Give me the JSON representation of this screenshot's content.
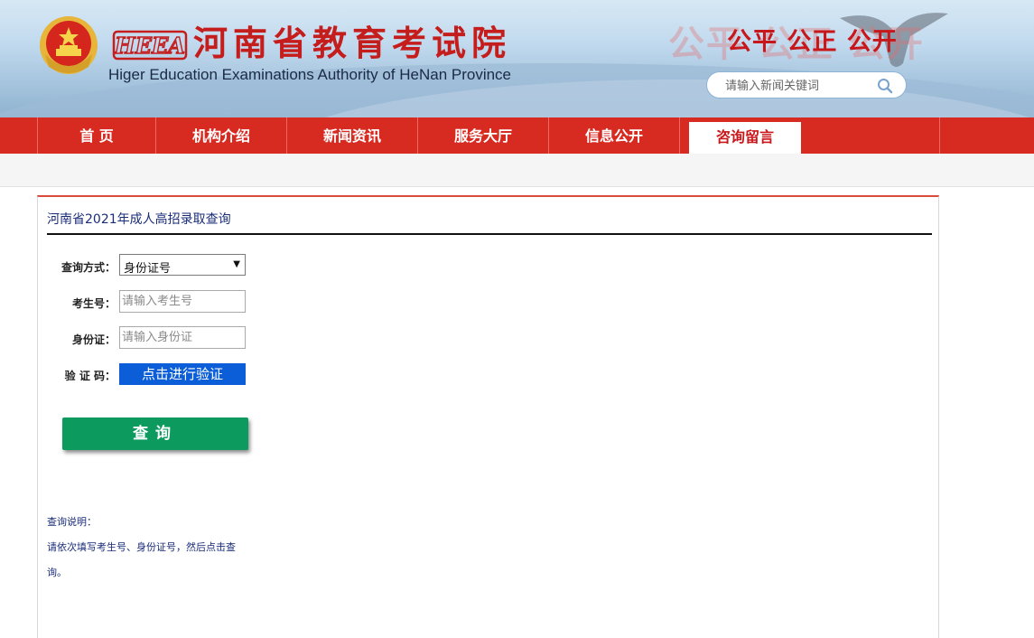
{
  "header": {
    "title": "河南省教育考试院",
    "subtitle": "Higer Education Examinations Authority of HeNan Province",
    "logo_text": "HEEA",
    "slogan": "公平 公正 公开",
    "search": {
      "placeholder": "请输入新闻关键词",
      "icon": "search-icon"
    }
  },
  "nav": {
    "items": [
      {
        "label": "首 页"
      },
      {
        "label": "机构介绍"
      },
      {
        "label": "新闻资讯"
      },
      {
        "label": "服务大厅"
      },
      {
        "label": "信息公开"
      },
      {
        "label": "咨询留言",
        "active": true
      }
    ]
  },
  "main": {
    "title": "河南省2021年成人高招录取查询",
    "form": {
      "method_label": "查询方式：",
      "method_value": "身份证号",
      "exam_no_label": "考生号：",
      "exam_no_placeholder": "请输入考生号",
      "id_label": "身份证：",
      "id_placeholder": "请输入身份证",
      "captcha_label": "验 证 码：",
      "captcha_button": "点击进行验证",
      "submit": "查询"
    },
    "notes": {
      "heading": "查询说明：",
      "line1": "请依次填写考生号、身份证号，然后点击查",
      "line2": "询。"
    }
  },
  "colors": {
    "brand_red": "#d72a21",
    "title_red": "#c51c1c",
    "verify_blue": "#0b5ed7",
    "submit_green": "#0c9a5f",
    "link_navy": "#1a2d7a"
  }
}
